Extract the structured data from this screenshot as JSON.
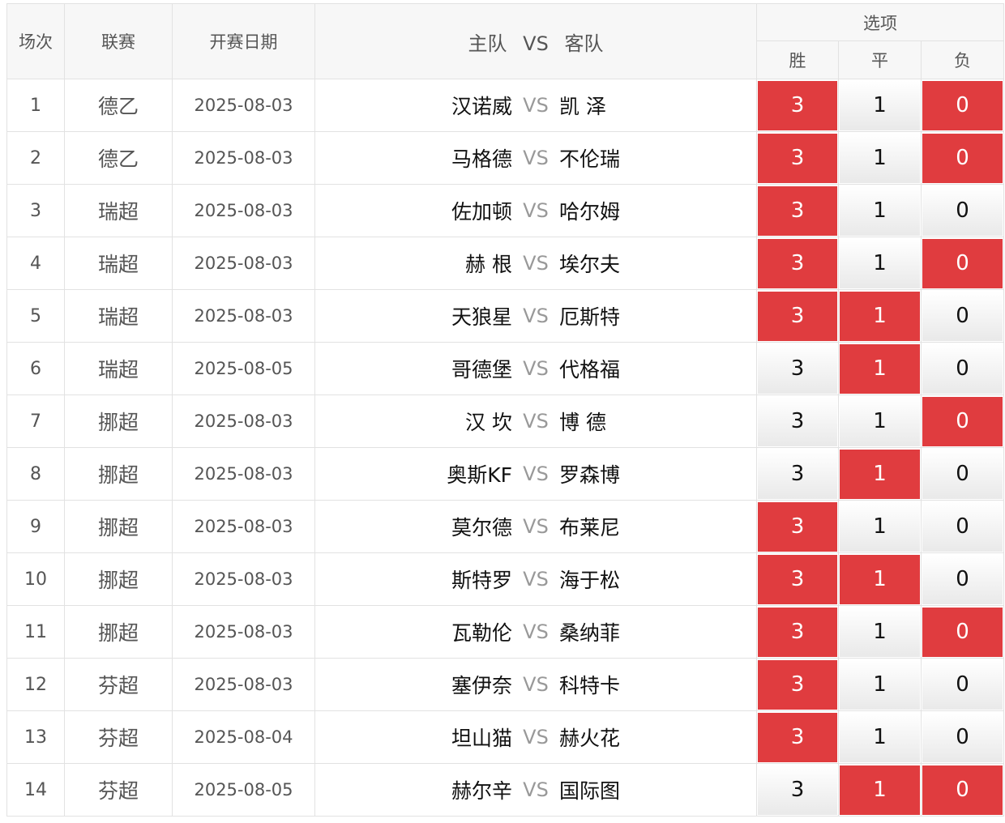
{
  "header": {
    "col_no": "场次",
    "col_league": "联赛",
    "col_date": "开赛日期",
    "col_home": "主队",
    "col_vs": "VS",
    "col_away": "客队",
    "col_options": "选项",
    "opt_win": "胜",
    "opt_draw": "平",
    "opt_lose": "负"
  },
  "vs_label": "VS",
  "colors": {
    "selected": "#e03c3f"
  },
  "rows": [
    {
      "no": "1",
      "league": "德乙",
      "date": "2025-08-03",
      "home": "汉诺威",
      "away": "凯 泽",
      "o3": "3",
      "o1": "1",
      "o0": "0",
      "sel": [
        true,
        false,
        true
      ]
    },
    {
      "no": "2",
      "league": "德乙",
      "date": "2025-08-03",
      "home": "马格德",
      "away": "不伦瑞",
      "o3": "3",
      "o1": "1",
      "o0": "0",
      "sel": [
        true,
        false,
        true
      ]
    },
    {
      "no": "3",
      "league": "瑞超",
      "date": "2025-08-03",
      "home": "佐加顿",
      "away": "哈尔姆",
      "o3": "3",
      "o1": "1",
      "o0": "0",
      "sel": [
        true,
        false,
        false
      ]
    },
    {
      "no": "4",
      "league": "瑞超",
      "date": "2025-08-03",
      "home": "赫 根",
      "away": "埃尔夫",
      "o3": "3",
      "o1": "1",
      "o0": "0",
      "sel": [
        true,
        false,
        true
      ]
    },
    {
      "no": "5",
      "league": "瑞超",
      "date": "2025-08-03",
      "home": "天狼星",
      "away": "厄斯特",
      "o3": "3",
      "o1": "1",
      "o0": "0",
      "sel": [
        true,
        true,
        false
      ]
    },
    {
      "no": "6",
      "league": "瑞超",
      "date": "2025-08-05",
      "home": "哥德堡",
      "away": "代格福",
      "o3": "3",
      "o1": "1",
      "o0": "0",
      "sel": [
        false,
        true,
        false
      ]
    },
    {
      "no": "7",
      "league": "挪超",
      "date": "2025-08-03",
      "home": "汉 坎",
      "away": "博 德",
      "o3": "3",
      "o1": "1",
      "o0": "0",
      "sel": [
        false,
        false,
        true
      ]
    },
    {
      "no": "8",
      "league": "挪超",
      "date": "2025-08-03",
      "home": "奥斯KF",
      "away": "罗森博",
      "o3": "3",
      "o1": "1",
      "o0": "0",
      "sel": [
        false,
        true,
        false
      ]
    },
    {
      "no": "9",
      "league": "挪超",
      "date": "2025-08-03",
      "home": "莫尔德",
      "away": "布莱尼",
      "o3": "3",
      "o1": "1",
      "o0": "0",
      "sel": [
        true,
        false,
        false
      ]
    },
    {
      "no": "10",
      "league": "挪超",
      "date": "2025-08-03",
      "home": "斯特罗",
      "away": "海于松",
      "o3": "3",
      "o1": "1",
      "o0": "0",
      "sel": [
        true,
        true,
        false
      ]
    },
    {
      "no": "11",
      "league": "挪超",
      "date": "2025-08-03",
      "home": "瓦勒伦",
      "away": "桑纳菲",
      "o3": "3",
      "o1": "1",
      "o0": "0",
      "sel": [
        true,
        false,
        true
      ]
    },
    {
      "no": "12",
      "league": "芬超",
      "date": "2025-08-03",
      "home": "塞伊奈",
      "away": "科特卡",
      "o3": "3",
      "o1": "1",
      "o0": "0",
      "sel": [
        true,
        false,
        false
      ]
    },
    {
      "no": "13",
      "league": "芬超",
      "date": "2025-08-04",
      "home": "坦山猫",
      "away": "赫火花",
      "o3": "3",
      "o1": "1",
      "o0": "0",
      "sel": [
        true,
        false,
        false
      ]
    },
    {
      "no": "14",
      "league": "芬超",
      "date": "2025-08-05",
      "home": "赫尔辛",
      "away": "国际图",
      "o3": "3",
      "o1": "1",
      "o0": "0",
      "sel": [
        false,
        true,
        true
      ]
    }
  ]
}
